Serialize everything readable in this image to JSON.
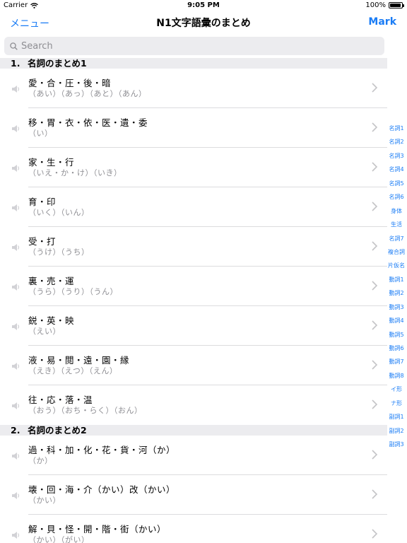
{
  "status_bar": {
    "carrier": "Carrier",
    "time": "9:05 PM",
    "battery": "100%"
  },
  "nav": {
    "left_button": "メニュー",
    "title": "N1文字語彙のまとめ",
    "right_button": "Mark"
  },
  "search": {
    "placeholder": "Search",
    "value": ""
  },
  "sections": [
    {
      "number": "1.",
      "title": "名詞のまとめ1",
      "rows": [
        {
          "kanji": "愛・合・圧・後・暗",
          "kana": "（あい）（あっ）（あと）（あん）"
        },
        {
          "kanji": "移・胃・衣・依・医・遺・委",
          "kana": "（い）"
        },
        {
          "kanji": "家・生・行",
          "kana": "（いえ・か・け）（いき）"
        },
        {
          "kanji": "育・印",
          "kana": "（いく）（いん）"
        },
        {
          "kanji": "受・打",
          "kana": "（うけ）（うち）"
        },
        {
          "kanji": "裏・売・運",
          "kana": "（うら）（うり）（うん）"
        },
        {
          "kanji": "鋭・英・映",
          "kana": "（えい）"
        },
        {
          "kanji": "液・易・閲・遠・園・縁",
          "kana": "（えき）（えつ）（えん）"
        },
        {
          "kanji": "往・応・落・温",
          "kana": "（おう）（おち・らく）（おん）"
        }
      ]
    },
    {
      "number": "2.",
      "title": "名詞のまとめ2",
      "rows": [
        {
          "kanji": "過・科・加・化・花・貨・河（か）",
          "kana": "（か）"
        },
        {
          "kanji": "壊・回・海・介（かい）改（かい）",
          "kana": "（かい）"
        },
        {
          "kanji": "解・貝・怪・開・階・街（かい）",
          "kana": "（かい）（がい）"
        }
      ]
    }
  ],
  "index": [
    "名詞1",
    "名詞2",
    "名詞3",
    "名詞4",
    "名詞5",
    "名詞6",
    "身体",
    "生活",
    "名詞7",
    "複合詞",
    "片仮名",
    "動詞1",
    "動詞2",
    "動詞3",
    "動詞4",
    "動詞5",
    "動詞6",
    "動詞7",
    "動詞8",
    "イ形",
    "ナ形",
    "副詞1",
    "副詞2",
    "副詞3"
  ],
  "colors": {
    "accent": "#1a7cf5",
    "section_bg": "#ececef",
    "secondary_text": "#8e8e93"
  },
  "icons": {
    "row_icon": "speaker-icon",
    "row_chevron": "chevron-right-icon"
  }
}
